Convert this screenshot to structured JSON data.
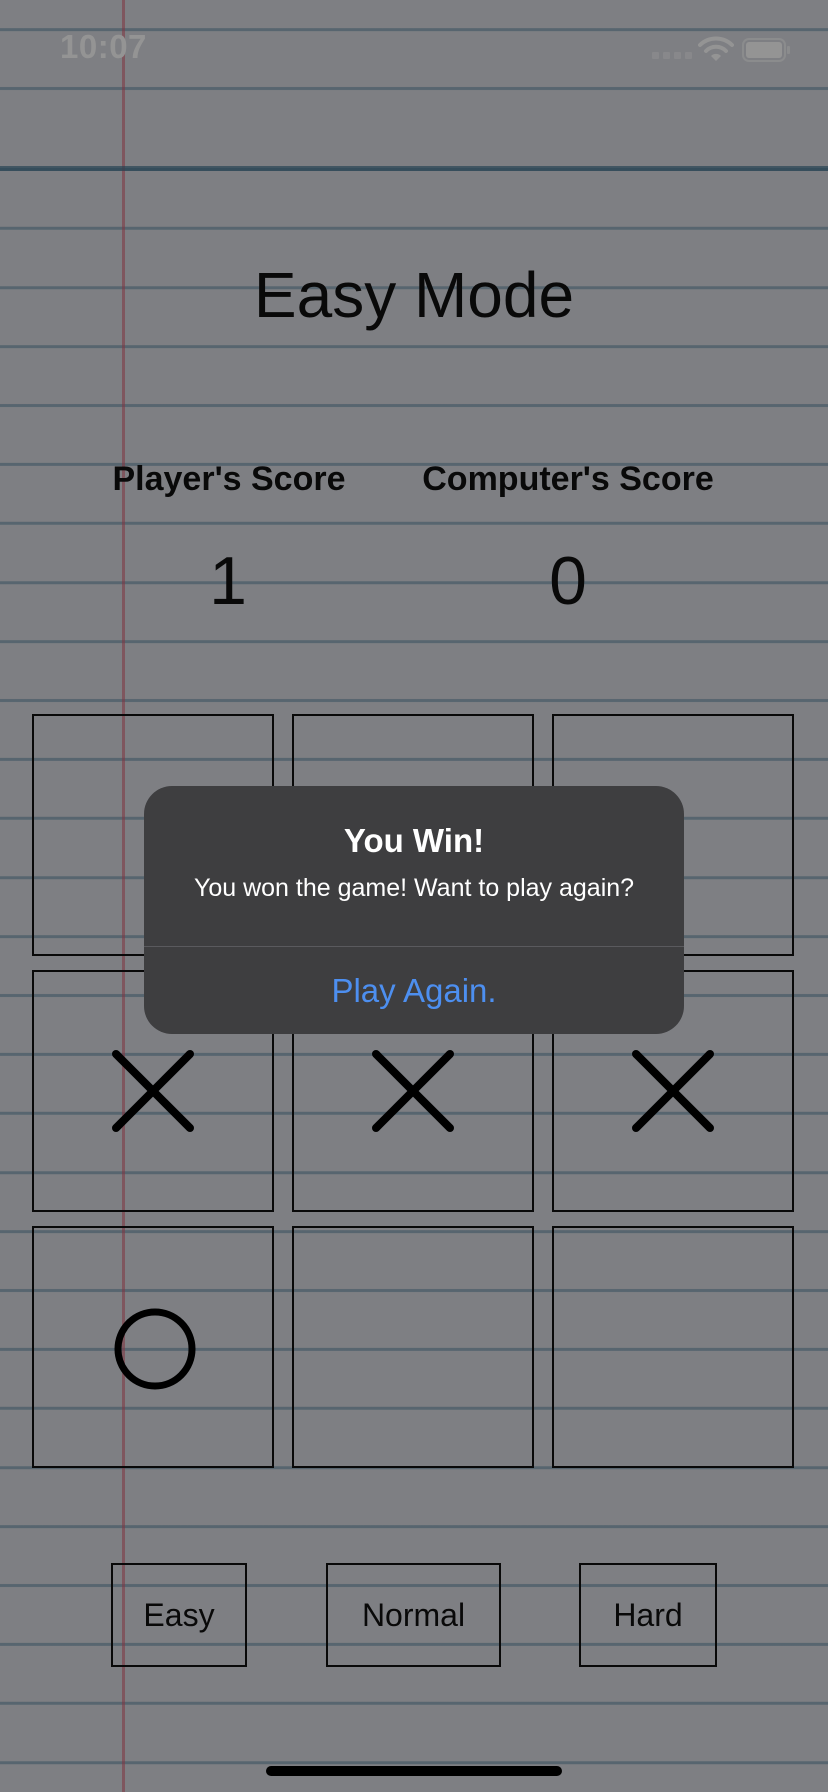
{
  "status_bar": {
    "time": "10:07",
    "wifi_icon": "wifi-icon",
    "battery_icon": "battery-icon"
  },
  "title": "Easy Mode",
  "scores": {
    "player_label": "Player's Score",
    "player_value": "1",
    "computer_label": "Computer's Score",
    "computer_value": "0"
  },
  "board": {
    "cells": [
      "",
      "",
      "",
      "X",
      "X",
      "X",
      "O",
      "",
      ""
    ]
  },
  "difficulty": {
    "easy_label": "Easy",
    "normal_label": "Normal",
    "hard_label": "Hard"
  },
  "alert": {
    "title": "You Win!",
    "message": "You won the game! Want to play again?",
    "button_label": "Play Again.",
    "button_color": "#4d8ff0"
  }
}
